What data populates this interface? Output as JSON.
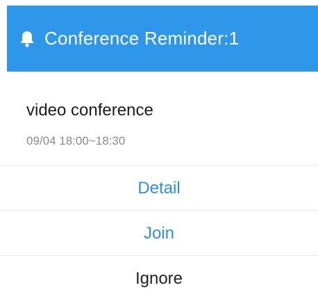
{
  "header": {
    "icon": "bell-icon",
    "title": "Conference Reminder:1",
    "background_color": "#2f97ea"
  },
  "meeting": {
    "name": "video conference",
    "time": "09/04 18:00~18:30"
  },
  "actions": {
    "detail_label": "Detail",
    "join_label": "Join",
    "ignore_label": "Ignore",
    "link_color": "#2f8fe6"
  }
}
